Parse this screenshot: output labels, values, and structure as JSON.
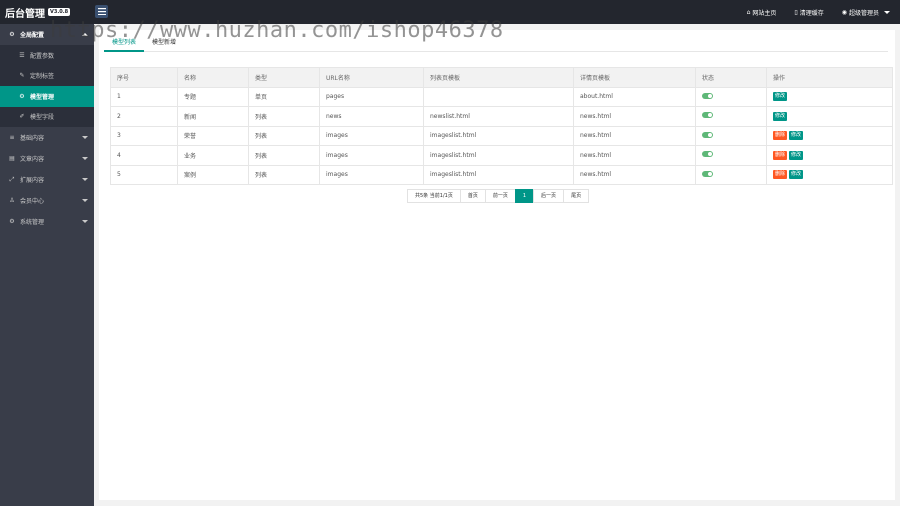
{
  "header": {
    "title": "后台管理",
    "version": "V3.0.8",
    "links": [
      {
        "label": "网站主页",
        "icon": "home-icon"
      },
      {
        "label": "清理缓存",
        "icon": "trash-icon"
      },
      {
        "label": "超级管理员",
        "icon": "user-icon"
      }
    ]
  },
  "sidebar": {
    "group": "全局配置",
    "sub_items": [
      "配置参数",
      "定制标签",
      "模型管理",
      "模型字段"
    ],
    "items": [
      "基础内容",
      "文章内容",
      "扩展内容",
      "会员中心",
      "系统管理"
    ]
  },
  "tabs": [
    "模型列表",
    "模型新增"
  ],
  "table": {
    "headers": [
      "序号",
      "名称",
      "类型",
      "URL名称",
      "列表页模板",
      "详情页模板",
      "状态",
      "操作"
    ],
    "rows": [
      [
        "1",
        "专题",
        "单页",
        "pages",
        "",
        "about.html"
      ],
      [
        "2",
        "新闻",
        "列表",
        "news",
        "newslist.html",
        "news.html"
      ],
      [
        "3",
        "荣誉",
        "列表",
        "images",
        "imageslist.html",
        "news.html"
      ],
      [
        "4",
        "业务",
        "列表",
        "images",
        "imageslist.html",
        "news.html"
      ],
      [
        "5",
        "案例",
        "列表",
        "images",
        "imageslist.html",
        "news.html"
      ]
    ],
    "delete_label": "删除",
    "edit_label": "修改"
  },
  "pagination": {
    "info": "共5条 当前1/1页",
    "first": "首页",
    "prev": "前一页",
    "current": "1",
    "next": "后一页",
    "last": "尾页"
  },
  "watermark": "https://www.huzhan.com/ishop46378",
  "colors": {
    "accent": "#009688",
    "danger": "#ff5722",
    "topbar": "#23262e",
    "sidebar": "#393d49"
  }
}
